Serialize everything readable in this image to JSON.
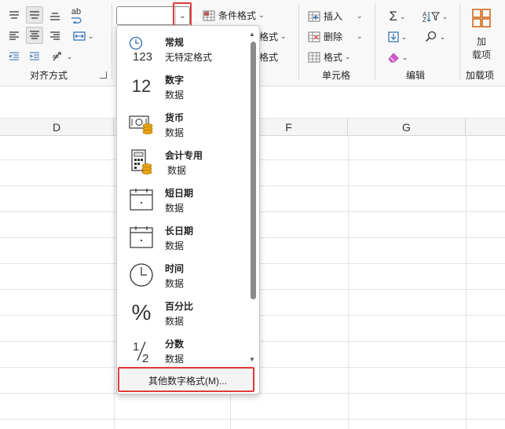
{
  "ribbon": {
    "alignment": {
      "group_label": "对齐方式",
      "wrap_icon_text": "ab"
    },
    "number": {
      "combo_value": "",
      "combo_dropdown_icon": "chevron-down-icon"
    },
    "styles": {
      "conditional_format": "条件格式",
      "table_format_partial": "格式",
      "cell_style_partial": "格式"
    },
    "cells": {
      "insert": "插入",
      "delete": "删除",
      "format": "格式",
      "group_label": "单元格"
    },
    "editing": {
      "group_label": "编辑"
    },
    "addins": {
      "button_label_line1": "加",
      "button_label_line2": "载项",
      "group_label": "加载项"
    }
  },
  "sheet": {
    "columns": [
      "D",
      "F",
      "G"
    ]
  },
  "number_format_dropdown": {
    "items": [
      {
        "title": "常规",
        "subtitle": "无特定格式",
        "icon": "clock-123-icon"
      },
      {
        "title": "数字",
        "subtitle": "数据",
        "icon": "number-12-icon"
      },
      {
        "title": "货币",
        "subtitle": "数据",
        "icon": "currency-icon"
      },
      {
        "title": "会计专用",
        "subtitle": "数据",
        "icon": "accounting-icon"
      },
      {
        "title": "短日期",
        "subtitle": "数据",
        "icon": "short-date-icon"
      },
      {
        "title": "长日期",
        "subtitle": "数据",
        "icon": "long-date-icon"
      },
      {
        "title": "时间",
        "subtitle": "数据",
        "icon": "clock-icon"
      },
      {
        "title": "百分比",
        "subtitle": "数据",
        "icon": "percent-icon"
      },
      {
        "title": "分数",
        "subtitle": "数据",
        "icon": "fraction-icon"
      }
    ],
    "icon_texts": {
      "general_digits": "123",
      "number_digits": "12",
      "percent_symbol": "%",
      "fraction_num": "1",
      "fraction_den": "2"
    },
    "more_formats": "其他数字格式(M)..."
  },
  "colors": {
    "highlight_red": "#e23a3a",
    "coin_gold": "#e8a317"
  }
}
